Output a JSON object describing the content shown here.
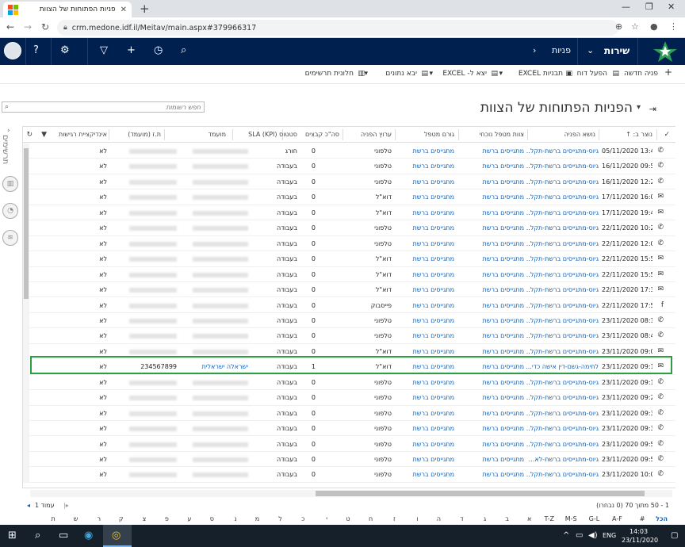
{
  "browser": {
    "tab_title": "פניות הפתוחות של הצוות",
    "url": "crm.medone.idf.il/Meitav/main.aspx#379966317"
  },
  "navbar": {
    "module": "שירות",
    "area": "פניות"
  },
  "commands": {
    "new_case": "פניה חדשה",
    "run_report": "הפעל דוח",
    "excel_templates": "תבניות EXCEL",
    "export_excel": "יצא ל- EXCEL",
    "import_data": "יבא נתונים",
    "dashboards": "חלונית תרשימים"
  },
  "view": {
    "title": "הפניות הפתוחות של הצוות",
    "search_placeholder": "חפש רשומות",
    "side_label": "תרשימים"
  },
  "columns": [
    "נוצר ב: ↑",
    "נושא הפניה",
    "צוות מטפל נוכחי",
    "גורם מטפל",
    "ערוץ הפניה",
    "סה\"כ קבצים",
    "סטטוס SLA (KPI)",
    "מועמד",
    "ת.ז (מועמד)",
    "אינדיקציית רגישות"
  ],
  "rows": [
    {
      "type": "phone",
      "created": "05/11/2020 13:45",
      "subject": "גיוס-מתגייסים ברשת-תקל...",
      "team": "מתגייסים ברשת",
      "handler": "מתגייסים ברשת",
      "channel": "טלפוני",
      "files": "0",
      "sla": "חורג",
      "candidate": "",
      "id": "",
      "sensitivity": "לא"
    },
    {
      "type": "phone",
      "created": "16/11/2020 09:53",
      "subject": "גיוס-מתגייסים ברשת-תקל...",
      "team": "מתגייסים ברשת",
      "handler": "מתגייסים ברשת",
      "channel": "טלפוני",
      "files": "0",
      "sla": "בעבודה",
      "candidate": "",
      "id": "",
      "sensitivity": "לא"
    },
    {
      "type": "phone",
      "created": "16/11/2020 12:21",
      "subject": "גיוס-מתגייסים ברשת-תקל...",
      "team": "מתגייסים ברשת",
      "handler": "מתגייסים ברשת",
      "channel": "טלפוני",
      "files": "0",
      "sla": "בעבודה",
      "candidate": "",
      "id": "",
      "sensitivity": "לא"
    },
    {
      "type": "mail",
      "created": "17/11/2020 16:01",
      "subject": "גיוס-מתגייסים ברשת-תקל...",
      "team": "מתגייסים ברשת",
      "handler": "מתגייסים ברשת",
      "channel": "דוא\"ל",
      "files": "0",
      "sla": "בעבודה",
      "candidate": "",
      "id": "",
      "sensitivity": "לא"
    },
    {
      "type": "mail",
      "created": "17/11/2020 19:45",
      "subject": "גיוס-מתגייסים ברשת-תקל...",
      "team": "מתגייסים ברשת",
      "handler": "מתגייסים ברשת",
      "channel": "דוא\"ל",
      "files": "0",
      "sla": "בעבודה",
      "candidate": "",
      "id": "",
      "sensitivity": "לא"
    },
    {
      "type": "phone",
      "created": "22/11/2020 10:22",
      "subject": "גיוס-מתגייסים ברשת-תקל...",
      "team": "מתגייסים ברשת",
      "handler": "מתגייסים ברשת",
      "channel": "טלפוני",
      "files": "0",
      "sla": "בעבודה",
      "candidate": "",
      "id": "",
      "sensitivity": "לא"
    },
    {
      "type": "phone",
      "created": "22/11/2020 12:03",
      "subject": "גיוס-מתגייסים ברשת-תקל...",
      "team": "מתגייסים ברשת",
      "handler": "מתגייסים ברשת",
      "channel": "טלפוני",
      "files": "0",
      "sla": "בעבודה",
      "candidate": "",
      "id": "",
      "sensitivity": "לא"
    },
    {
      "type": "mail",
      "created": "22/11/2020 15:57",
      "subject": "גיוס-מתגייסים ברשת-תקל...",
      "team": "מתגייסים ברשת",
      "handler": "מתגייסים ברשת",
      "channel": "דוא\"ל",
      "files": "0",
      "sla": "בעבודה",
      "candidate": "",
      "id": "",
      "sensitivity": "לא"
    },
    {
      "type": "mail",
      "created": "22/11/2020 15:59",
      "subject": "גיוס-מתגייסים ברשת-תקל...",
      "team": "מתגייסים ברשת",
      "handler": "מתגייסים ברשת",
      "channel": "דוא\"ל",
      "files": "0",
      "sla": "בעבודה",
      "candidate": "",
      "id": "",
      "sensitivity": "לא"
    },
    {
      "type": "mail",
      "created": "22/11/2020 17:37",
      "subject": "גיוס-מתגייסים ברשת-תקל...",
      "team": "מתגייסים ברשת",
      "handler": "מתגייסים ברשת",
      "channel": "דוא\"ל",
      "files": "0",
      "sla": "בעבודה",
      "candidate": "",
      "id": "",
      "sensitivity": "לא"
    },
    {
      "type": "facebook",
      "created": "22/11/2020 17:54",
      "subject": "גיוס-מתגייסים ברשת-תקל...",
      "team": "מתגייסים ברשת",
      "handler": "מתגייסים ברשת",
      "channel": "פייסבוק",
      "files": "0",
      "sla": "בעבודה",
      "candidate": "",
      "id": "",
      "sensitivity": "לא"
    },
    {
      "type": "phone",
      "created": "23/11/2020 08:11",
      "subject": "גיוס-מתגייסים ברשת-תקל...",
      "team": "מתגייסים ברשת",
      "handler": "מתגייסים ברשת",
      "channel": "טלפוני",
      "files": "0",
      "sla": "בעבודה",
      "candidate": "",
      "id": "",
      "sensitivity": "לא"
    },
    {
      "type": "phone",
      "created": "23/11/2020 08:44",
      "subject": "גיוס-מתגייסים ברשת-תקל...",
      "team": "מתגייסים ברשת",
      "handler": "מתגייסים ברשת",
      "channel": "טלפוני",
      "files": "0",
      "sla": "בעבודה",
      "candidate": "",
      "id": "",
      "sensitivity": "לא"
    },
    {
      "type": "mail",
      "created": "23/11/2020 09:01",
      "subject": "גיוס-מתגייסים ברשת-תקל...",
      "team": "מתגייסים ברשת",
      "handler": "מתגייסים ברשת",
      "channel": "דוא\"ל",
      "files": "0",
      "sla": "בעבודה",
      "candidate": "",
      "id": "",
      "sensitivity": "לא"
    },
    {
      "type": "mail",
      "created": "23/11/2020 09:10",
      "subject": "לחימה-גשם-דין אישה כדי...",
      "team": "מתגייסים ברשת",
      "handler": "מתגייסים ברשת",
      "channel": "דוא\"ל",
      "files": "1",
      "sla": "בעבודה",
      "candidate": "ישראלה ישראלית",
      "id": "234567899",
      "sensitivity": "לא",
      "highlight": true
    },
    {
      "type": "phone",
      "created": "23/11/2020 09:17",
      "subject": "גיוס-מתגייסים ברשת-תקל...",
      "team": "מתגייסים ברשת",
      "handler": "מתגייסים ברשת",
      "channel": "טלפוני",
      "files": "0",
      "sla": "בעבודה",
      "candidate": "",
      "id": "",
      "sensitivity": "לא"
    },
    {
      "type": "phone",
      "created": "23/11/2020 09:29",
      "subject": "גיוס-מתגייסים ברשת-תקל...",
      "team": "מתגייסים ברשת",
      "handler": "מתגייסים ברשת",
      "channel": "טלפוני",
      "files": "0",
      "sla": "בעבודה",
      "candidate": "",
      "id": "",
      "sensitivity": "לא"
    },
    {
      "type": "phone",
      "created": "23/11/2020 09:31",
      "subject": "גיוס-מתגייסים ברשת-תקל...",
      "team": "מתגייסים ברשת",
      "handler": "מתגייסים ברשת",
      "channel": "טלפוני",
      "files": "0",
      "sla": "בעבודה",
      "candidate": "",
      "id": "",
      "sensitivity": "לא"
    },
    {
      "type": "phone",
      "created": "23/11/2020 09:38",
      "subject": "גיוס-מתגייסים ברשת-תקל...",
      "team": "מתגייסים ברשת",
      "handler": "מתגייסים ברשת",
      "channel": "טלפוני",
      "files": "0",
      "sla": "בעבודה",
      "candidate": "",
      "id": "",
      "sensitivity": "לא"
    },
    {
      "type": "phone",
      "created": "23/11/2020 09:53",
      "subject": "גיוס-מתגייסים ברשת-תקל...",
      "team": "מתגייסים ברשת",
      "handler": "מתגייסים ברשת",
      "channel": "טלפוני",
      "files": "0",
      "sla": "בעבודה",
      "candidate": "",
      "id": "",
      "sensitivity": "לא"
    },
    {
      "type": "phone",
      "created": "23/11/2020 09:58",
      "subject": "גיוס-מתגייסים ברשת-לא...",
      "team": "מתגייסים ברשת",
      "handler": "מתגייסים ברשת",
      "channel": "טלפוני",
      "files": "0",
      "sla": "בעבודה",
      "candidate": "",
      "id": "",
      "sensitivity": "לא"
    },
    {
      "type": "phone",
      "created": "23/11/2020 10:00",
      "subject": "גיוס-מתגייסים ברשת-תקל...",
      "team": "מתגייסים ברשת",
      "handler": "מתגייסים ברשת",
      "channel": "טלפוני",
      "files": "0",
      "sla": "בעבודה",
      "candidate": "",
      "id": "",
      "sensitivity": "לא"
    }
  ],
  "footer": {
    "record_count": "1 - 50 מתוך 70 (0 נבחרו)",
    "page_label": "עמוד 1"
  },
  "alphabet": [
    "הכל",
    "#",
    "A-F",
    "G-L",
    "M-S",
    "T-Z",
    "א",
    "ב",
    "ג",
    "ד",
    "ה",
    "ו",
    "ז",
    "ח",
    "ט",
    "י",
    "כ",
    "ל",
    "מ",
    "נ",
    "ס",
    "ע",
    "פ",
    "צ",
    "ק",
    "ר",
    "ש",
    "ת"
  ],
  "taskbar": {
    "language": "ENG",
    "time": "14:03",
    "date": "23/11/2020"
  },
  "colors": {
    "navbar": "#002050",
    "link": "#1160b7",
    "highlight_border": "#2e9e45"
  }
}
